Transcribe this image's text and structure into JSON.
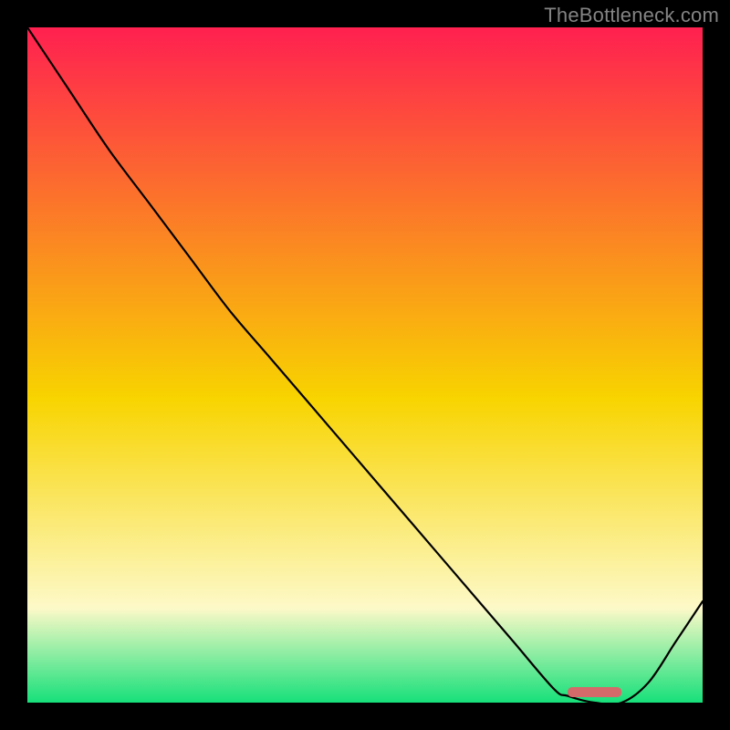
{
  "attribution": "TheBottleneck.com",
  "colors": {
    "gradient_top": "#ff2050",
    "gradient_mid": "#f8d400",
    "gradient_pale": "#fdf9c8",
    "gradient_bottom": "#16e07a",
    "curve": "#000000",
    "marker": "#d56a6a",
    "frame": "#000000"
  },
  "chart_data": {
    "type": "line",
    "title": "",
    "xlabel": "",
    "ylabel": "",
    "x": [
      0.0,
      0.06,
      0.12,
      0.18,
      0.24,
      0.3,
      0.36,
      0.42,
      0.48,
      0.54,
      0.6,
      0.66,
      0.72,
      0.78,
      0.8,
      0.84,
      0.88,
      0.92,
      0.96,
      1.0
    ],
    "values": [
      1.0,
      0.91,
      0.82,
      0.74,
      0.66,
      0.58,
      0.51,
      0.44,
      0.37,
      0.3,
      0.23,
      0.16,
      0.09,
      0.02,
      0.01,
      0.0,
      0.0,
      0.03,
      0.09,
      0.15
    ],
    "xlim": [
      0,
      1
    ],
    "ylim": [
      0,
      1
    ],
    "inflection_x": 0.24,
    "optimal_range_x": [
      0.8,
      0.88
    ],
    "note": "x and y are normalized to the plot frame; y=1 is top (worst/red), y=0 is bottom (best/green). Curve starts top-left, bends slightly at x≈0.24, descends nearly linearly to a minimum around x≈0.80–0.88, then rises toward the right edge."
  }
}
